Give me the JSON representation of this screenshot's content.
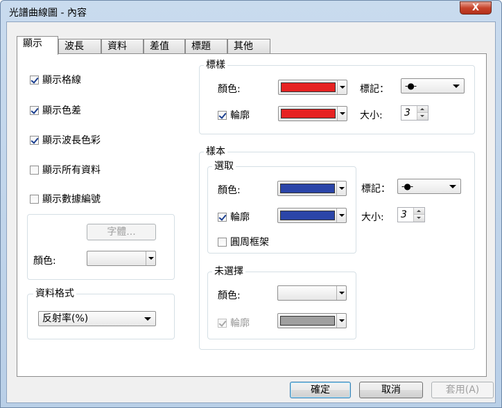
{
  "window": {
    "title": "光譜曲線圖 - 內容",
    "close_label": "X"
  },
  "tabs": [
    {
      "label": "顯示",
      "active": true
    },
    {
      "label": "波長"
    },
    {
      "label": "資料"
    },
    {
      "label": "差值"
    },
    {
      "label": "標題"
    },
    {
      "label": "其他"
    }
  ],
  "display": {
    "options": [
      {
        "label": "顯示格線",
        "checked": true
      },
      {
        "label": "顯示色差",
        "checked": true
      },
      {
        "label": "顯示波長色彩",
        "checked": true
      },
      {
        "label": "顯示所有資料",
        "checked": false
      },
      {
        "label": "顯示數據編號",
        "checked": false
      }
    ],
    "font_button": "字體...",
    "color_label": "顏色:",
    "data_format": {
      "label": "資料格式",
      "value": "反射率(%)"
    }
  },
  "standard": {
    "label": "標樣",
    "color_label": "顏色:",
    "color": "#e62222",
    "outline_label": "輪廓",
    "outline_checked": true,
    "outline_color": "#e62222",
    "marker_label": "標記：",
    "marker_value": "-●-",
    "size_label": "大小:",
    "size_value": "3"
  },
  "sample": {
    "label": "樣本",
    "selected": {
      "label": "選取",
      "color_label": "顏色:",
      "color": "#2b45a8",
      "outline_label": "輪廓",
      "outline_checked": true,
      "outline_color": "#2b45a8",
      "frame_label": "圓周框架",
      "frame_checked": false
    },
    "marker_label": "標記：",
    "marker_value": "-●-",
    "size_label": "大小:",
    "size_value": "3",
    "unselected": {
      "label": "未選擇",
      "color_label": "顏色:",
      "outline_label": "輪廓",
      "outline_checked": true,
      "outline_color": "#a0a0a0"
    }
  },
  "buttons": {
    "ok": "確定",
    "cancel": "取消",
    "apply": "套用(A)"
  }
}
